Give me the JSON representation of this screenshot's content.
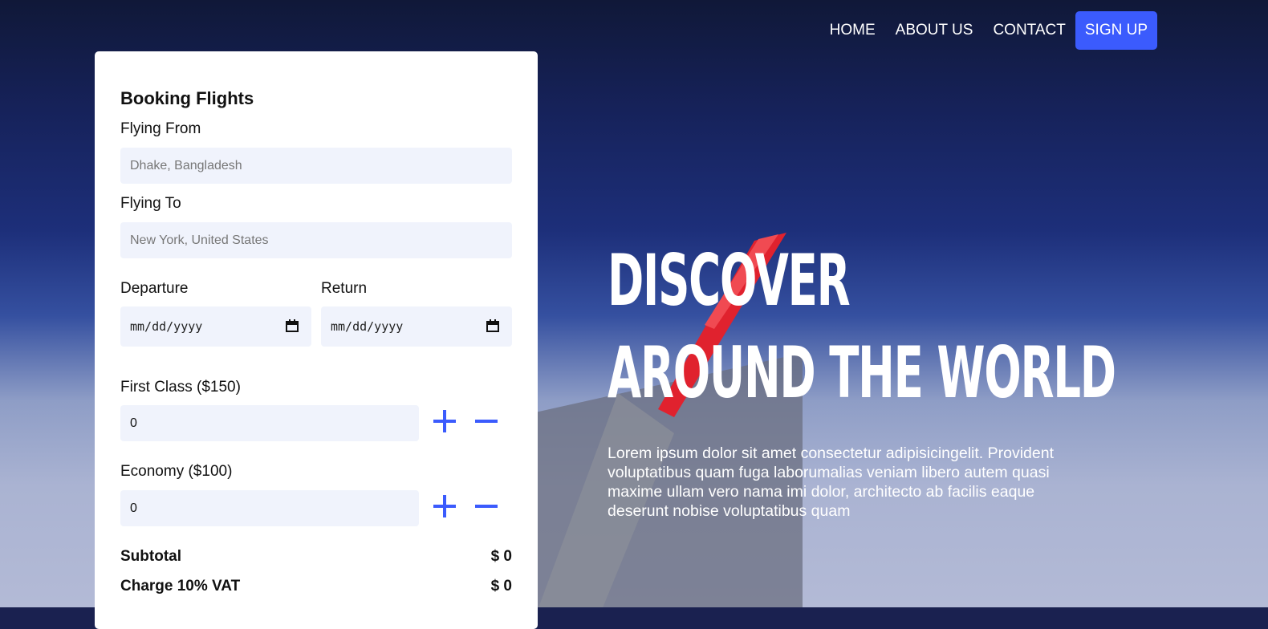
{
  "nav": {
    "items": [
      "HOME",
      "ABOUT US",
      "CONTACT"
    ],
    "signup_label": "SIGN UP"
  },
  "booking": {
    "title": "Booking Flights",
    "from_label": "Flying From",
    "from_placeholder": "Dhake, Bangladesh",
    "to_label": "Flying To",
    "to_placeholder": "New York, United States",
    "departure_label": "Departure",
    "return_label": "Return",
    "date_placeholder": "mm/dd/yyyy",
    "first_class_label": "First Class ($150)",
    "first_class_value": "0",
    "economy_label": "Economy ($100)",
    "economy_value": "0",
    "subtotal_label": "Subtotal",
    "subtotal_value": "$ 0",
    "vat_label": "Charge 10% VAT",
    "vat_value": "$ 0"
  },
  "hero": {
    "line1": "DISCOVER",
    "line2": "AROUND THE WORLD",
    "paragraph": "Lorem ipsum dolor sit amet consectetur adipisicingelit. Provident voluptatibus quam fuga laborumalias veniam libero autem quasi maxime ullam vero nama imi dolor, architecto ab facilis eaque deserunt nobise voluptatibus quam"
  },
  "colors": {
    "accent": "#3b5bfd",
    "input_bg": "#f0f3fc"
  }
}
